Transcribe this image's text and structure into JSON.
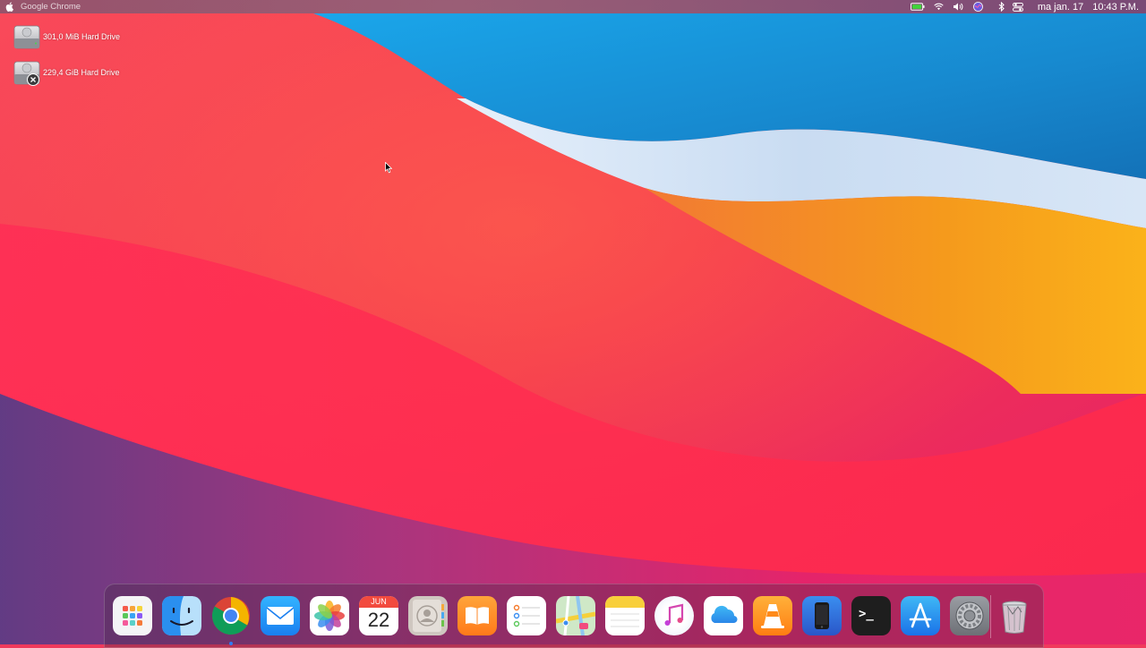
{
  "menubar": {
    "active_app": "Google Chrome",
    "date": "ma jan. 17",
    "time": "10:43 P.M.",
    "tray_icons": [
      "battery-icon",
      "wifi-icon",
      "volume-icon",
      "siri-icon",
      "bluetooth-icon",
      "control-center-icon"
    ]
  },
  "desktop": {
    "items": [
      {
        "label": "301,0 MiB Hard Drive",
        "icon": "hard-drive-icon"
      },
      {
        "label": "229,4 GiB Hard Drive",
        "icon": "hard-drive-eject-icon"
      }
    ]
  },
  "dock": {
    "calendar": {
      "month": "JUN",
      "day": "22"
    },
    "terminal_glyph": ">_",
    "apps": [
      "Launchpad",
      "Finder",
      "Google Chrome",
      "Mail",
      "Photos",
      "Calendar",
      "Contacts",
      "Books",
      "Reminders",
      "Maps",
      "Notes",
      "iTunes",
      "iCloud",
      "VLC",
      "Simulator",
      "Terminal",
      "App Store",
      "System Preferences",
      "Trash"
    ],
    "running": [
      "Google Chrome"
    ]
  },
  "colors": {
    "menubar_text": "#ffffff",
    "running_indicator": "#2d7cf6"
  }
}
